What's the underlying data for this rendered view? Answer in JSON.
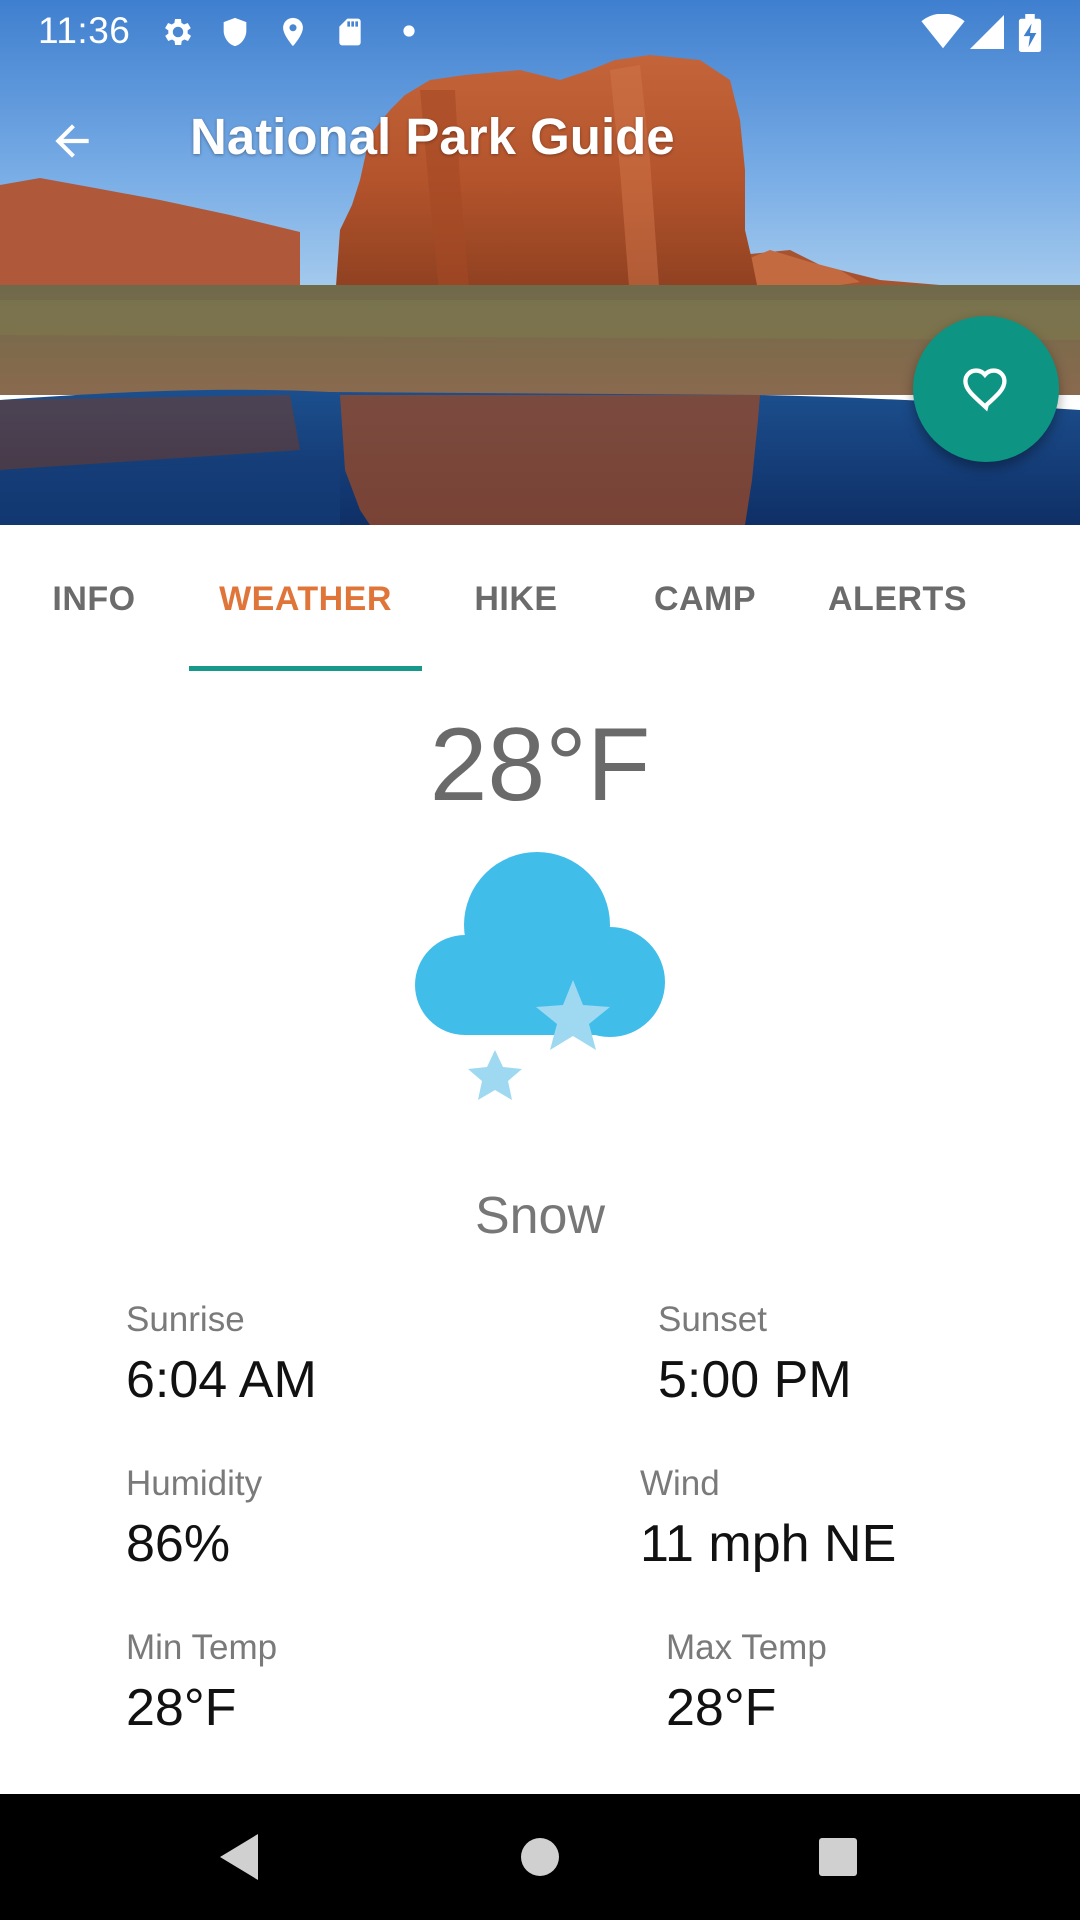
{
  "status_bar": {
    "time": "11:36",
    "icons_left": [
      "settings-icon",
      "shield-icon",
      "location-icon",
      "sd-card-icon",
      "dot-icon"
    ],
    "icons_right": [
      "wifi-icon",
      "signal-icon",
      "battery-charging-icon"
    ]
  },
  "toolbar": {
    "title": "National Park Guide",
    "back_icon": "arrow-back-icon"
  },
  "fab": {
    "icon": "heart-outline-icon",
    "color": "#0e9483"
  },
  "tabs": [
    {
      "label": "INFO",
      "active": false
    },
    {
      "label": "WEATHER",
      "active": true
    },
    {
      "label": "HIKE",
      "active": false
    },
    {
      "label": "CAMP",
      "active": false
    },
    {
      "label": "ALERTS",
      "active": false
    }
  ],
  "colors": {
    "active_tab": "#e0753a",
    "tab_indicator": "#17988b",
    "inactive_tab": "#6b6b6b"
  },
  "weather": {
    "temperature": "28°F",
    "icon": "snow-cloud-icon",
    "condition": "Snow",
    "details": {
      "sunrise_label": "Sunrise",
      "sunrise_value": "6:04 AM",
      "sunset_label": "Sunset",
      "sunset_value": "5:00 PM",
      "humidity_label": "Humidity",
      "humidity_value": "86%",
      "wind_label": "Wind",
      "wind_value": "11 mph NE",
      "min_temp_label": "Min Temp",
      "min_temp_value": "28°F",
      "max_temp_label": "Max Temp",
      "max_temp_value": "28°F"
    }
  },
  "nav_bar": {
    "buttons": [
      "back-triangle-icon",
      "home-circle-icon",
      "recents-square-icon"
    ]
  }
}
